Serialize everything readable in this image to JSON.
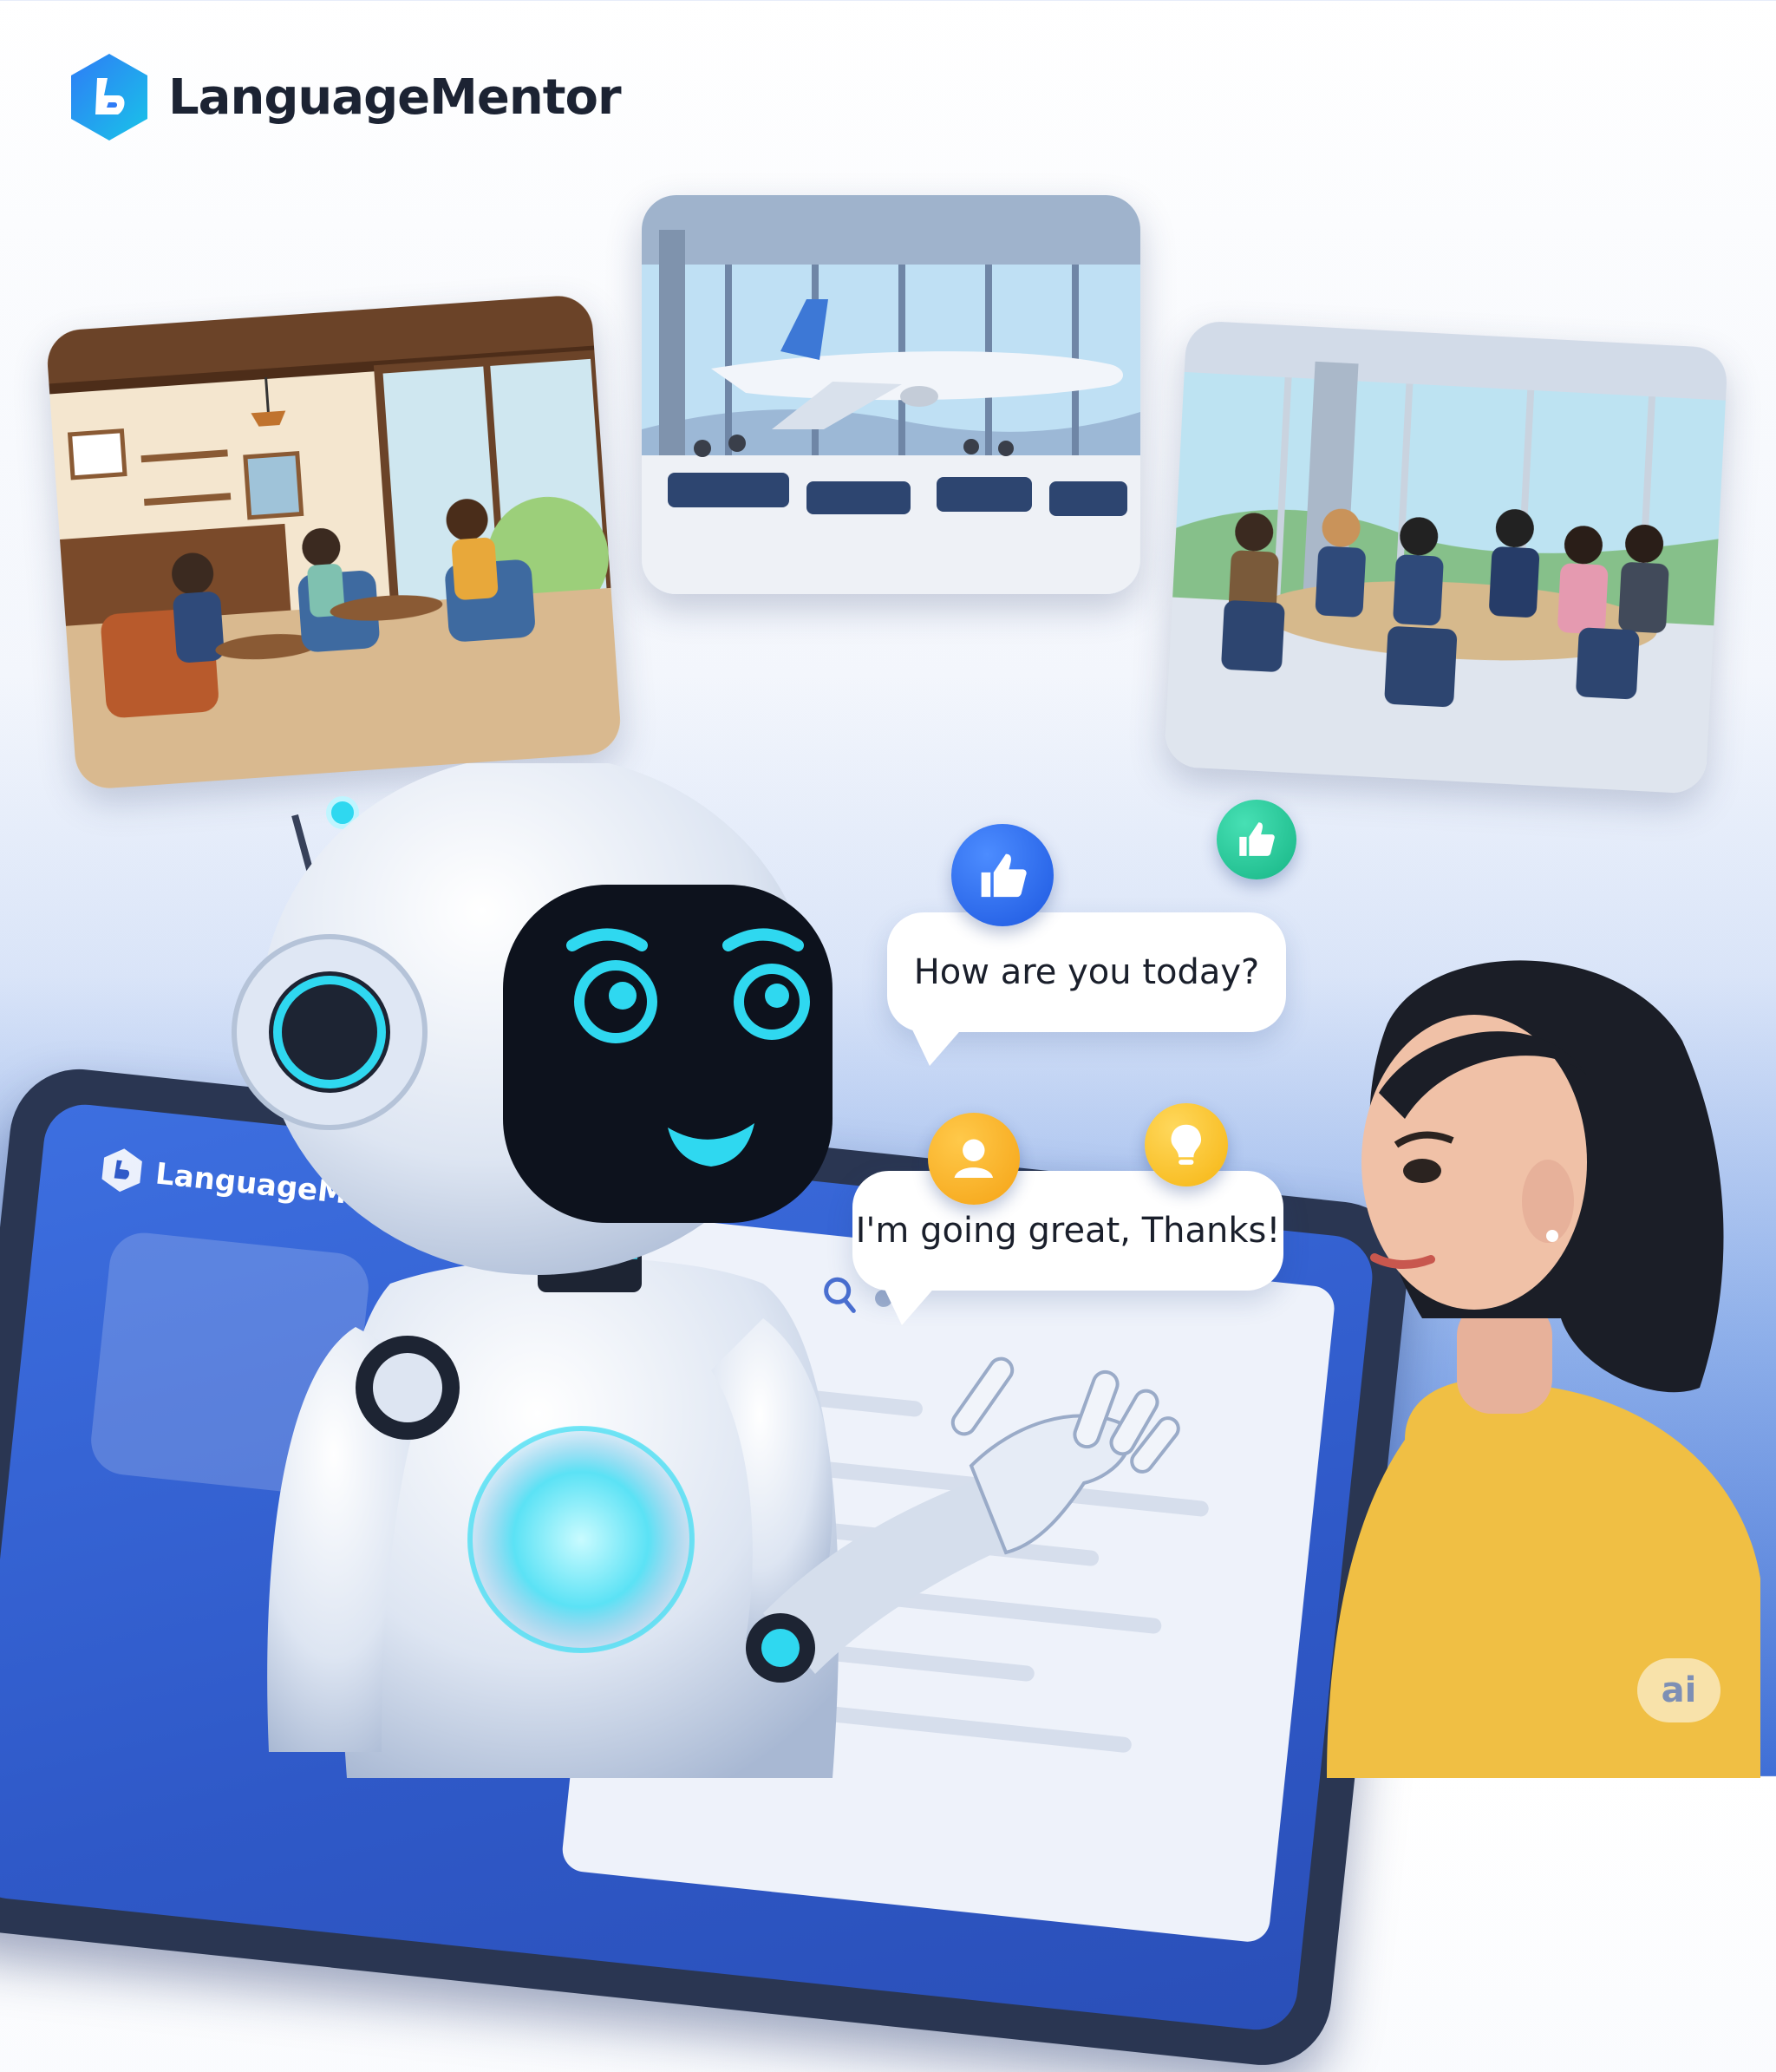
{
  "brand": {
    "name": "LanguageMentor",
    "logo_icon": "hexagon-logo-icon"
  },
  "tablet": {
    "brand_name": "LanguageMentor"
  },
  "scenes": [
    {
      "name": "cafe-scene"
    },
    {
      "name": "airport-scene"
    },
    {
      "name": "meeting-scene"
    }
  ],
  "conversation": {
    "question": "How are you today?",
    "answer": "I'm going great, Thanks!"
  },
  "reactions": [
    "thumbs-up-icon",
    "thumbs-up-chat-icon",
    "person-icon",
    "lightbulb-icon"
  ],
  "watermark": "ai",
  "colors": {
    "brand_blue": "#1f6fe0",
    "accent_cyan": "#2fd8f0",
    "page_blue": "#3f6fd6"
  }
}
